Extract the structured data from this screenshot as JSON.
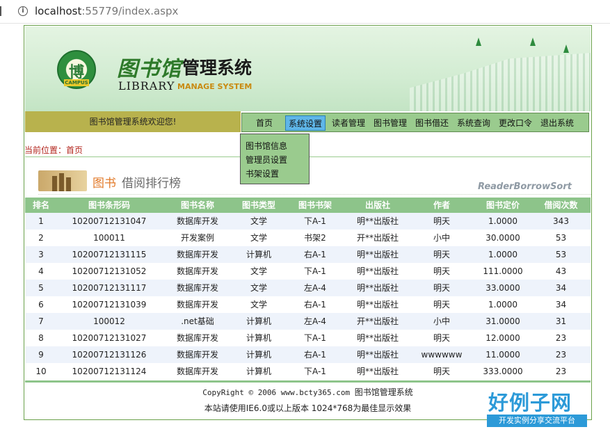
{
  "browser": {
    "url_host": "localhost",
    "url_port": ":55779",
    "url_path": "/index.aspx"
  },
  "banner": {
    "logo_glyph": "博",
    "logo_ribbon": "CAMPUS",
    "title_art": "图书馆",
    "title_cn": "管理系统",
    "title_en": "LIBRARY",
    "title_en_sub": "MANAGE SYSTEM"
  },
  "welcome": "图书馆管理系统欢迎您!",
  "nav": {
    "items": [
      "首页",
      "系统设置",
      "读者管理",
      "图书管理",
      "图书借还",
      "系统查询",
      "更改口令",
      "退出系统"
    ],
    "active_index": 1
  },
  "dropdown": {
    "items": [
      "图书馆信息",
      "管理员设置",
      "书架设置"
    ]
  },
  "breadcrumb": "当前位置：首页",
  "section": {
    "title_highlight": "图书",
    "title_rest": "借阅排行榜",
    "title_en": "ReaderBorrowSort"
  },
  "table": {
    "headers": [
      "排名",
      "图书条形码",
      "图书名称",
      "图书类型",
      "图书书架",
      "出版社",
      "作者",
      "图书定价",
      "借阅次数"
    ],
    "rows": [
      [
        "1",
        "10200712131047",
        "数据库开发",
        "文学",
        "下A-1",
        "明**出版社",
        "明天",
        "1.0000",
        "343"
      ],
      [
        "2",
        "100011",
        "开发案例",
        "文学",
        "书架2",
        "开**出版社",
        "小中",
        "30.0000",
        "53"
      ],
      [
        "3",
        "10200712131115",
        "数据库开发",
        "计算机",
        "右A-1",
        "明**出版社",
        "明天",
        "1.0000",
        "53"
      ],
      [
        "4",
        "10200712131052",
        "数据库开发",
        "文学",
        "下A-1",
        "明**出版社",
        "明天",
        "111.0000",
        "43"
      ],
      [
        "5",
        "10200712131117",
        "数据库开发",
        "文学",
        "左A-4",
        "明**出版社",
        "明天",
        "33.0000",
        "34"
      ],
      [
        "6",
        "10200712131039",
        "数据库开发",
        "文学",
        "右A-1",
        "明**出版社",
        "明天",
        "1.0000",
        "34"
      ],
      [
        "7",
        "100012",
        ".net基础",
        "计算机",
        "左A-4",
        "开**出版社",
        "小中",
        "31.0000",
        "31"
      ],
      [
        "8",
        "10200712131027",
        "数据库开发",
        "计算机",
        "下A-1",
        "明**出版社",
        "明天",
        "12.0000",
        "23"
      ],
      [
        "9",
        "10200712131126",
        "数据库开发",
        "计算机",
        "右A-1",
        "明**出版社",
        "wwwwww",
        "11.0000",
        "23"
      ],
      [
        "10",
        "10200712131124",
        "数据库开发",
        "计算机",
        "下A-1",
        "明**出版社",
        "明天",
        "333.0000",
        "23"
      ]
    ]
  },
  "footer": {
    "copyright": "CopyRight © 2006 www.bcty365.com",
    "copyright_cn": "图书馆管理系统",
    "note": "本站请使用IE6.0或以上版本 1024*768为最佳显示效果"
  },
  "watermark": {
    "big": "好例子网",
    "small": "开发实例分享交流平台"
  },
  "colors": {
    "nav_bg": "#9acb8e",
    "active_tab": "#5fb6e8",
    "welcome_bg": "#b8b24d",
    "table_head": "#8dc48a",
    "crumb": "#b3261e"
  }
}
